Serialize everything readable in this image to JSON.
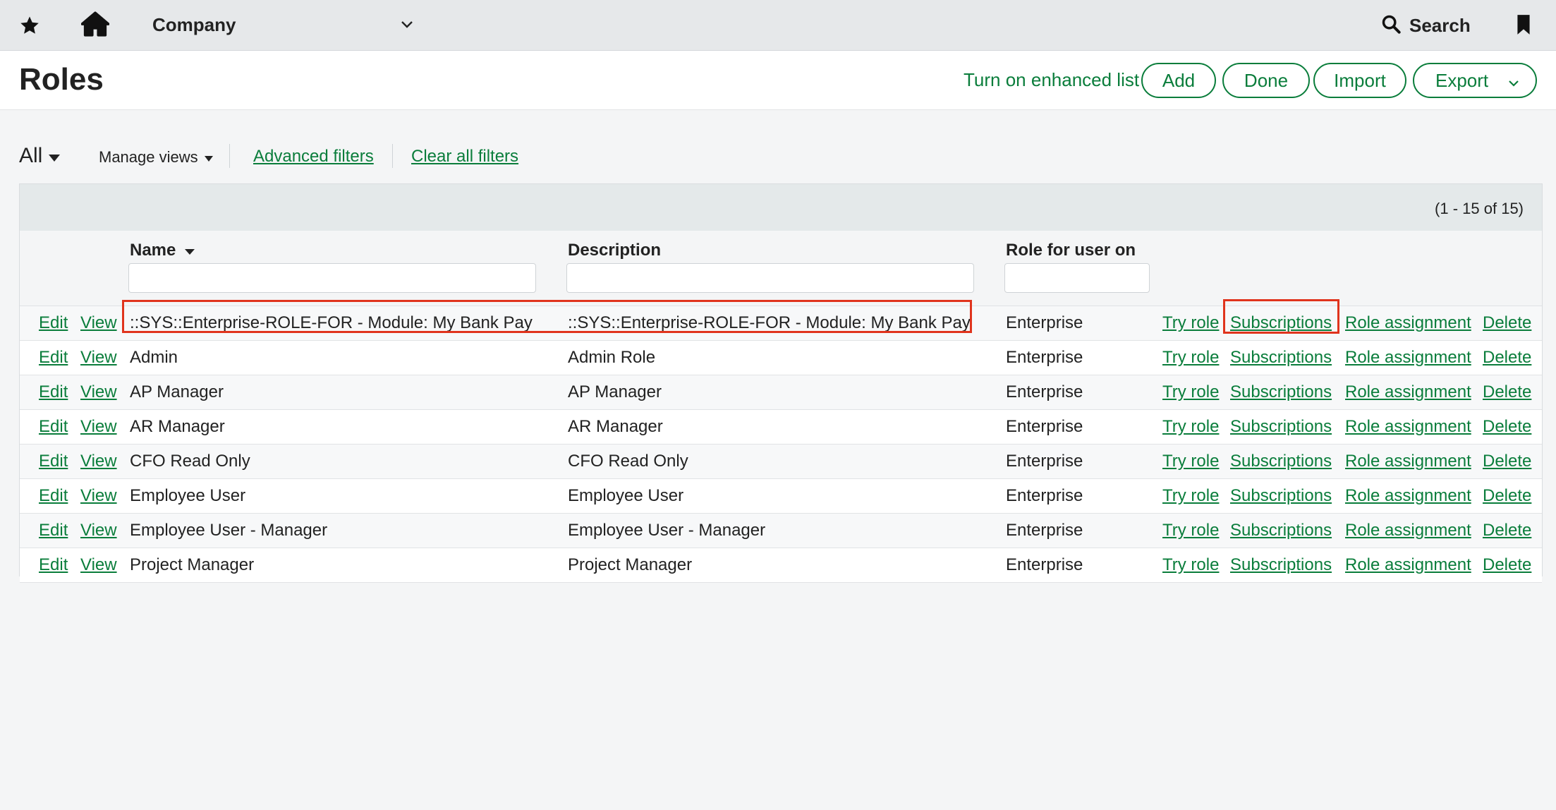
{
  "topbar": {
    "company": "Company",
    "search_label": "Search",
    "icons": [
      "star-icon",
      "home-icon",
      "chevron-down-icon",
      "search-icon",
      "bookmark-icon"
    ]
  },
  "header": {
    "title": "Roles",
    "enhanced_list": "Turn on enhanced list",
    "add": "Add",
    "done": "Done",
    "import": "Import",
    "export": "Export"
  },
  "filters": {
    "view": "All",
    "manage_views": "Manage views",
    "advanced_filters": "Advanced filters",
    "clear_all_filters": "Clear all filters"
  },
  "table": {
    "count": "(1 - 15 of 15)",
    "columns": {
      "name": "Name",
      "description": "Description",
      "role_for_user_on": "Role for user on"
    },
    "actions": {
      "edit": "Edit",
      "view": "View",
      "try_role": "Try role",
      "subscriptions": "Subscriptions",
      "role_assignment": "Role assignment",
      "delete": "Delete"
    },
    "rows": [
      {
        "name": "::SYS::Enterprise-ROLE-FOR - Module: My Bank Pay",
        "description": "::SYS::Enterprise-ROLE-FOR - Module: My Bank Pay",
        "role_for": "Enterprise"
      },
      {
        "name": "Admin",
        "description": "Admin Role",
        "role_for": "Enterprise"
      },
      {
        "name": "AP Manager",
        "description": "AP Manager",
        "role_for": "Enterprise"
      },
      {
        "name": "AR Manager",
        "description": "AR Manager",
        "role_for": "Enterprise"
      },
      {
        "name": "CFO Read Only",
        "description": "CFO Read Only",
        "role_for": "Enterprise"
      },
      {
        "name": "Employee User",
        "description": "Employee User",
        "role_for": "Enterprise"
      },
      {
        "name": "Employee User - Manager",
        "description": "Employee User - Manager",
        "role_for": "Enterprise"
      },
      {
        "name": "Project Manager",
        "description": "Project Manager",
        "role_for": "Enterprise"
      }
    ]
  },
  "colors": {
    "accent": "#0a7d3b",
    "highlight": "#e0341d",
    "topbar_bg": "#e6e8ea"
  }
}
